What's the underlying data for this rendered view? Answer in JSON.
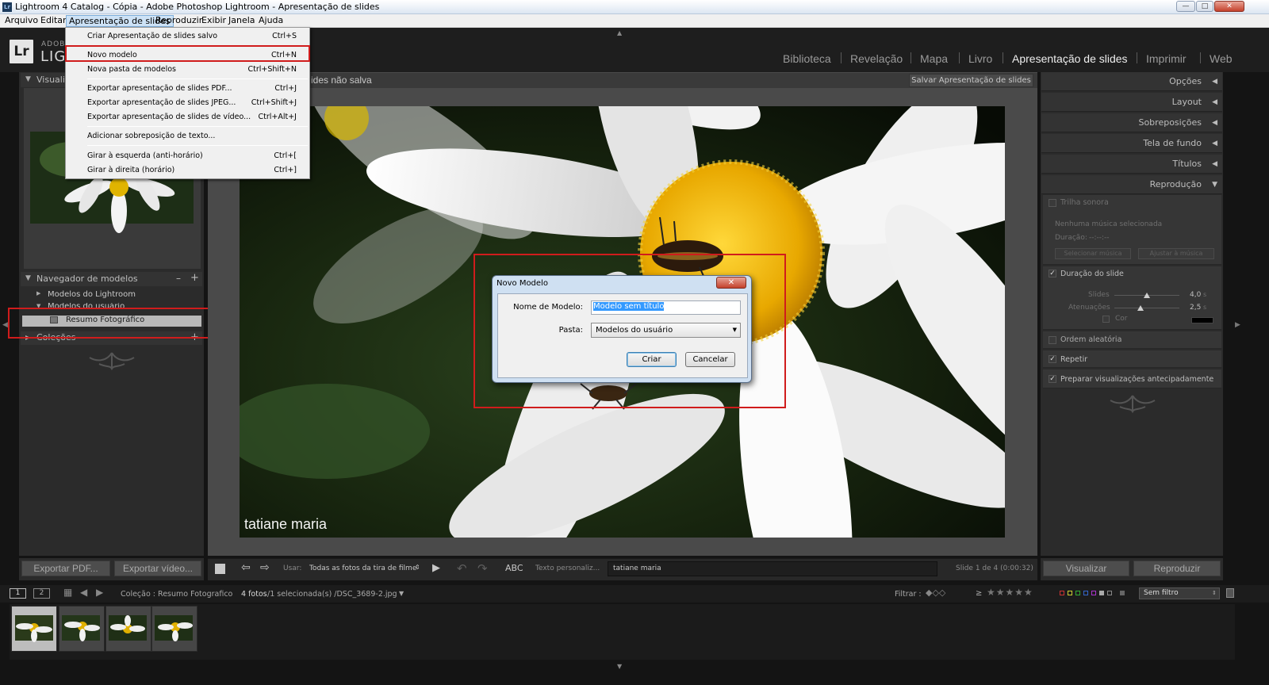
{
  "window": {
    "app_icon": "Lr",
    "title": "Lightroom 4 Catalog - Cópia - Adobe Photoshop Lightroom - Apresentação de slides",
    "controls": {
      "minimize": "—",
      "maximize": "□",
      "close": "✕"
    }
  },
  "menubar": {
    "items": [
      "Arquivo",
      "Editar",
      "Apresentação de slides",
      "Reproduzir",
      "Exibir",
      "Janela",
      "Ajuda"
    ],
    "active": "Apresentação de slides"
  },
  "dropdown": {
    "items": [
      {
        "label": "Criar Apresentação de slides salvo",
        "shortcut": "Ctrl+S"
      },
      {
        "label": "Novo modelo",
        "shortcut": "Ctrl+N"
      },
      {
        "label": "Nova pasta de modelos",
        "shortcut": "Ctrl+Shift+N"
      },
      {
        "label": "Exportar apresentação de slides PDF...",
        "shortcut": "Ctrl+J"
      },
      {
        "label": "Exportar apresentação de slides JPEG...",
        "shortcut": "Ctrl+Shift+J"
      },
      {
        "label": "Exportar apresentação de slides de vídeo...",
        "shortcut": "Ctrl+Alt+J"
      },
      {
        "label": "Adicionar sobreposição de texto...",
        "shortcut": ""
      },
      {
        "label": "Girar à esquerda (anti-horário)",
        "shortcut": "Ctrl+["
      },
      {
        "label": "Girar à direita (horário)",
        "shortcut": "Ctrl+]"
      }
    ],
    "highlighted": "Novo modelo"
  },
  "branding": {
    "badge": "Lr",
    "line1": "ADOBE",
    "line2": "LIGHTROOM"
  },
  "modules": [
    "Biblioteca",
    "Revelação",
    "Mapa",
    "Livro",
    "Apresentação de slides",
    "Imprimir",
    "Web"
  ],
  "active_module": "Apresentação de slides",
  "left_panel": {
    "preview_header": "Visualiz",
    "template_browser": {
      "title": "Navegador de modelos",
      "minus": "–",
      "plus": "+",
      "folders": [
        {
          "label": "Modelos do Lightroom",
          "expanded": false
        },
        {
          "label": "Modelos do usuário",
          "expanded": true,
          "children": [
            "Resumo Fotográfico"
          ]
        }
      ]
    },
    "collections_header": "Coleções",
    "collections_plus": "+"
  },
  "center": {
    "doc_title": "ides não salva",
    "save_button": "Salvar Apresentação de slides",
    "photo_caption": "tatiane maria"
  },
  "dialog": {
    "title": "Novo Modelo",
    "close": "✕",
    "name_label": "Nome de Modelo:",
    "name_value": "Modelo sem título",
    "folder_label": "Pasta:",
    "folder_value": "Modelos do usuário",
    "create_button": "Criar",
    "cancel_button": "Cancelar"
  },
  "right_panel": {
    "sections": [
      "Opções",
      "Layout",
      "Sobreposições",
      "Tela de fundo",
      "Títulos",
      "Reprodução"
    ],
    "soundtrack": {
      "label": "Trilha sonora",
      "checked": false,
      "no_music": "Nenhuma música selecionada",
      "duration_label": "Duração:",
      "duration_value": "--:--:--",
      "select_music": "Selecionar música",
      "fit_music": "Ajustar à música"
    },
    "slide_duration": {
      "label": "Duração do slide",
      "checked": true,
      "slides_label": "Slides",
      "slides_value": "4,0",
      "slides_level": 0.5,
      "fades_label": "Atenuações",
      "fades_value": "2,5",
      "fades_level": 0.4,
      "color_label": "Cor",
      "unit": "s"
    },
    "random_order": {
      "label": "Ordem aleatória",
      "checked": false
    },
    "repeat": {
      "label": "Repetir",
      "checked": true
    },
    "prepare_previews": {
      "label": "Preparar visualizações antecipadamente",
      "checked": true
    }
  },
  "bottom_left": {
    "export_pdf": "Exportar PDF...",
    "export_video": "Exportar vídeo..."
  },
  "toolbar": {
    "use_label": "Usar:",
    "use_value": "Todas as fotos da tira de filme",
    "abc": "ABC",
    "custom_text_label": "Texto personaliz...",
    "custom_text_value": "tatiane maria",
    "slide_status": "Slide 1 de 4 (0:00:32)"
  },
  "bottom_right": {
    "preview": "Visualizar",
    "play": "Reproduzir"
  },
  "filmbar": {
    "screen1": "1",
    "screen2": "2",
    "collection": "Coleção : Resumo Fotografico",
    "count": "4 fotos",
    "selection": "/1 selecionada(s) /DSC_3689-2.jpg",
    "filter_label": "Filtrar :",
    "rating_op": "≥",
    "stars": "★★★★★",
    "filter_value": "Sem filtro"
  },
  "filmstrip": {
    "thumbnails": 4,
    "selected_index": 0
  },
  "colors": {
    "accent_red": "#d01c1c",
    "panel_bg": "#2b2b2b",
    "selection_blue": "#3399ff"
  }
}
